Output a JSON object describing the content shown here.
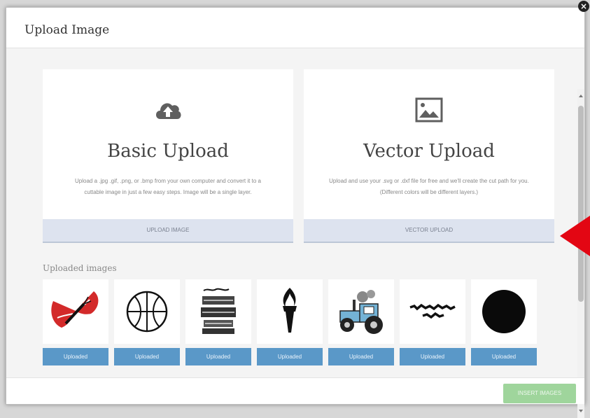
{
  "modal": {
    "title": "Upload Image",
    "close_icon": "×"
  },
  "basic": {
    "icon": "cloud-upload-icon",
    "title": "Basic Upload",
    "description": "Upload a .jpg .gif, .png, or .bmp from your own computer and convert it to a cuttable image in just a few easy steps. Image will be a single layer.",
    "button_label": "UPLOAD IMAGE"
  },
  "vector": {
    "icon": "image-icon",
    "title": "Vector Upload",
    "description": "Upload and use your .svg or .dxf file for free and we'll create the cut path for you. (Different colors will be different layers.)",
    "button_label": "VECTOR UPLOAD"
  },
  "uploaded": {
    "heading": "Uploaded images",
    "items": [
      {
        "image": "butterfly-icon",
        "label": "Uploaded"
      },
      {
        "image": "basketball-icon",
        "label": "Uploaded"
      },
      {
        "image": "text-design-icon",
        "label": "Uploaded"
      },
      {
        "image": "torch-icon",
        "label": "Uploaded"
      },
      {
        "image": "tractor-icon",
        "label": "Uploaded"
      },
      {
        "image": "text-happening-icon",
        "label": "Uploaded"
      },
      {
        "image": "black-circle-icon",
        "label": "Uploaded"
      }
    ]
  },
  "footer": {
    "insert_label": "INSERT IMAGES"
  },
  "colors": {
    "accent_blue": "#5a98c8",
    "insert_green": "#9fd59c",
    "arrow_red": "#e30613"
  }
}
